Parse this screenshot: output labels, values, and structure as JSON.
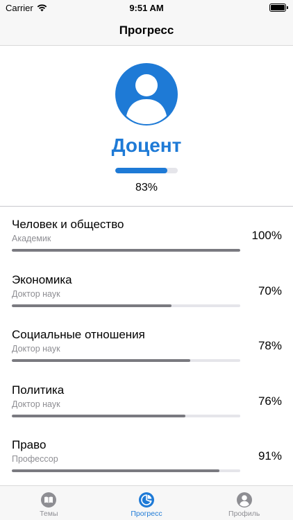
{
  "status_bar": {
    "carrier": "Carrier",
    "time": "9:51 AM"
  },
  "nav": {
    "title": "Прогресс"
  },
  "profile": {
    "rank": "Доцент",
    "overall_percent_label": "83%",
    "overall_progress": 0.83,
    "accent_color": "#1e7ad6"
  },
  "topics": [
    {
      "name": "Человек и общество",
      "level": "Академик",
      "percent_label": "100%",
      "progress": 1.0
    },
    {
      "name": "Экономика",
      "level": "Доктор наук",
      "percent_label": "70%",
      "progress": 0.7
    },
    {
      "name": "Социальные отношения",
      "level": "Доктор наук",
      "percent_label": "78%",
      "progress": 0.78
    },
    {
      "name": "Политика",
      "level": "Доктор наук",
      "percent_label": "76%",
      "progress": 0.76
    },
    {
      "name": "Право",
      "level": "Профессор",
      "percent_label": "91%",
      "progress": 0.91
    }
  ],
  "tab_bar": {
    "tabs": [
      {
        "label": "Темы",
        "icon": "book-icon",
        "active": false
      },
      {
        "label": "Прогресс",
        "icon": "pie-chart-icon",
        "active": true
      },
      {
        "label": "Профиль",
        "icon": "person-icon",
        "active": false
      }
    ]
  }
}
